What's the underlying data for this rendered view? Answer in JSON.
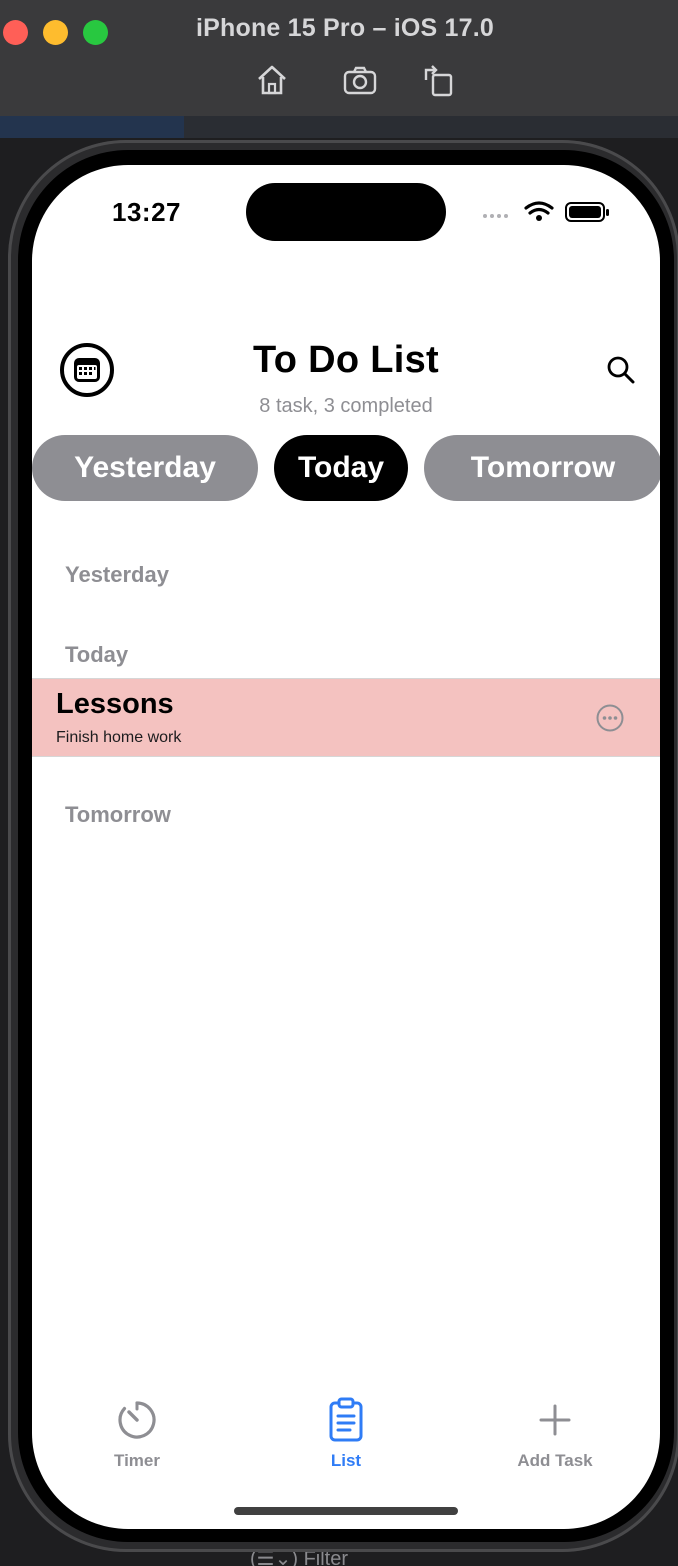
{
  "simulator": {
    "title": "iPhone 15 Pro – iOS 17.0",
    "buttons": [
      "home-icon",
      "screenshot-icon",
      "rotate-icon"
    ]
  },
  "ide": {
    "bottom_hint": "(☰⌄) Filter"
  },
  "status_bar": {
    "time": "13:27"
  },
  "header": {
    "title": "To Do List",
    "subtitle": "8 task, 3 completed"
  },
  "segments": [
    {
      "label": "Yesterday",
      "active": false
    },
    {
      "label": "Today",
      "active": true
    },
    {
      "label": "Tomorrow",
      "active": false
    }
  ],
  "sections": {
    "yesterday": "Yesterday",
    "today": "Today",
    "tomorrow": "Tomorrow"
  },
  "tasks": [
    {
      "title": "Lessons",
      "description": "Finish home work",
      "color": "#f4c2c0"
    }
  ],
  "tab_bar": {
    "timer": "Timer",
    "list": "List",
    "add": "Add Task",
    "active_color": "#2f7cf6",
    "inactive_color": "#8e8e93"
  }
}
